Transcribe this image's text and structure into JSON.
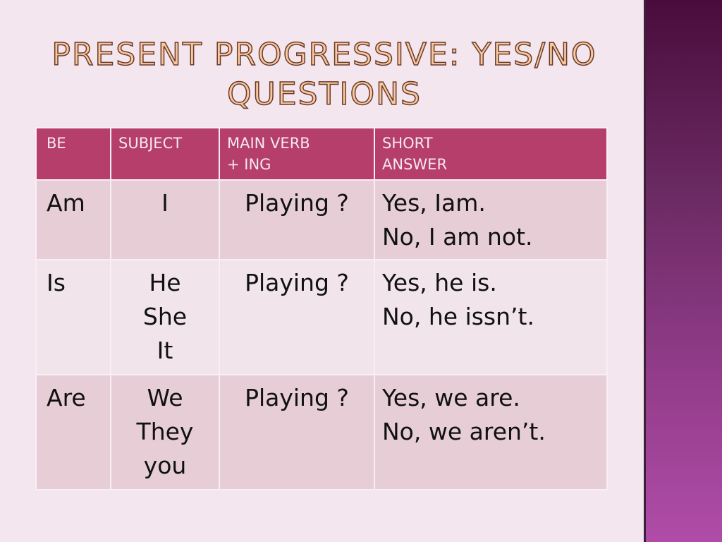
{
  "slide": {
    "title_line1": "PRESENT PROGRESSIVE: YES/NO",
    "title_line2": "QUESTIONS"
  },
  "table": {
    "headers": {
      "be": "BE",
      "subject": "SUBJECT",
      "main_verb_line1": "MAIN VERB",
      "main_verb_line2": "+ ING",
      "short_answer_line1": "SHORT",
      "short_answer_line2": "ANSWER"
    },
    "rows": [
      {
        "be": "Am",
        "subjects": [
          "I"
        ],
        "verb": "Playing ?",
        "answers": [
          "Yes, Iam.",
          "No, I am not."
        ]
      },
      {
        "be": "Is",
        "subjects": [
          "He",
          "She",
          "It"
        ],
        "verb": "Playing ?",
        "answers": [
          "Yes, he is.",
          "No, he issn’t."
        ]
      },
      {
        "be": "Are",
        "subjects": [
          "We",
          "They",
          "you"
        ],
        "verb": "Playing ?",
        "answers": [
          "Yes, we are.",
          "No, we aren’t."
        ]
      }
    ]
  },
  "colors": {
    "header_bg": "#b53e6b",
    "row_dark": "#e6cdd6",
    "row_light": "#f1e4ea",
    "page_bg": "#f4e6ee",
    "title_fill": "#f6c9a0",
    "side_panel_top": "#4a0c3c",
    "side_panel_bottom": "#b04ca8"
  }
}
